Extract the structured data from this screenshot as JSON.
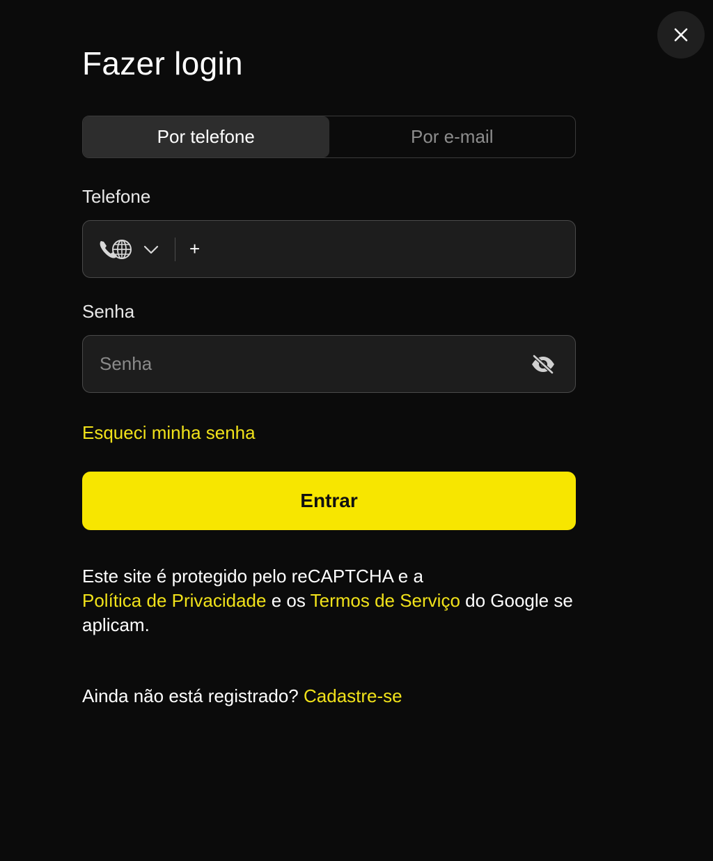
{
  "modal": {
    "title": "Fazer login",
    "close_icon": "close-icon"
  },
  "tabs": [
    {
      "label": "Por telefone",
      "active": true
    },
    {
      "label": "Por e-mail",
      "active": false
    }
  ],
  "phone": {
    "label": "Telefone",
    "country_icon": "globe-phone-icon",
    "dropdown_icon": "chevron-down-icon",
    "value": "+"
  },
  "password": {
    "label": "Senha",
    "placeholder": "Senha",
    "value": "",
    "toggle_icon": "eye-off-icon"
  },
  "forgot_link": "Esqueci minha senha",
  "submit_label": "Entrar",
  "recaptcha": {
    "text_before": "Este site é protegido pelo reCAPTCHA e a",
    "privacy_link": "Política de Privacidade",
    "text_middle": " e os ",
    "terms_link": "Termos de Serviço",
    "text_after": " do Google se aplicam."
  },
  "register": {
    "prompt": "Ainda não está registrado? ",
    "link": "Cadastre-se"
  },
  "colors": {
    "background": "#0b0b0b",
    "accent": "#f7e600",
    "link": "#f1e21a",
    "input_bg": "#1d1d1d",
    "tab_active_bg": "#2d2d2d"
  }
}
